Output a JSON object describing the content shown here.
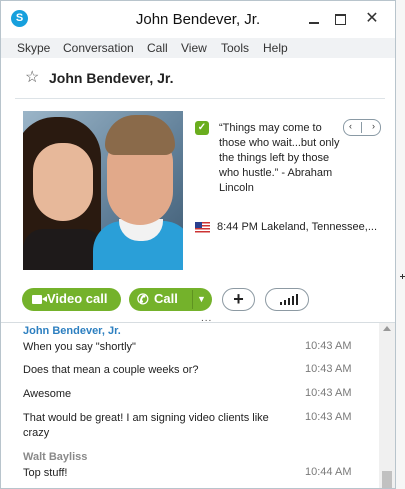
{
  "window": {
    "title": "John Bendever, Jr.",
    "app_icon": "S",
    "close_glyph": "✕"
  },
  "menu": [
    "Skype",
    "Conversation",
    "Call",
    "View",
    "Tools",
    "Help"
  ],
  "contact": {
    "name": "John Bendever, Jr.",
    "star_glyph": "☆",
    "mood": "“Things may come to those who wait...but only the things left by those who hustle.” - Abraham Lincoln",
    "location": "8:44 PM Lakeland, Tennessee,...",
    "pager_prev": "‹",
    "pager_next": "›"
  },
  "actions": {
    "video_call": "Video call",
    "call": "Call",
    "call_glyph": "✆",
    "dropdown_glyph": "▼",
    "add_glyph": "+",
    "splitter": "..."
  },
  "messages": [
    {
      "sender": "John Bendever, Jr.",
      "sender_color": "#2c7fc0"
    },
    {
      "text": "When you say \"shortly\"",
      "time": "10:43 AM"
    },
    {
      "text": "Does that mean a couple weeks or?",
      "time": "10:43 AM"
    },
    {
      "text": "Awesome",
      "time": "10:43 AM"
    },
    {
      "text": "That would be great!  I am signing video clients like crazy",
      "time": "10:43 AM"
    },
    {
      "sender": "Walt Bayliss",
      "sender_color": "#8a8a8a"
    },
    {
      "text": "Top stuff!",
      "time": "10:44 AM"
    }
  ],
  "colors": {
    "accent_green": "#74b22b",
    "skype_blue": "#17a0dd"
  }
}
